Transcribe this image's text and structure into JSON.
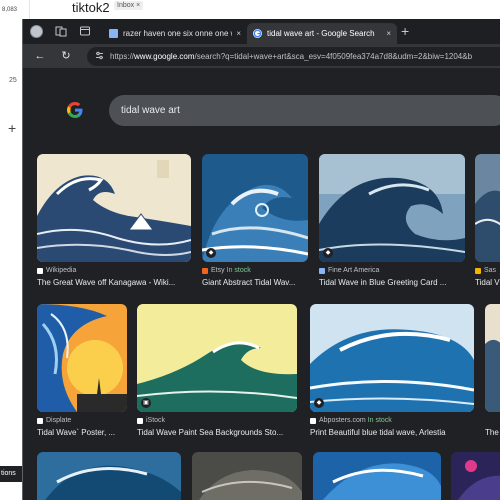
{
  "background_page": {
    "title": "tiktok2",
    "inbox_badge": "Inbox",
    "count": "8,083",
    "left_number": "25",
    "plus": "+",
    "bottom_tip": "tions"
  },
  "tabs": [
    {
      "label": "razer haven one six onne one wo",
      "close": "×",
      "active": false
    },
    {
      "label": "tidal wave art - Google Search",
      "close": "×",
      "active": true
    }
  ],
  "new_tab": "+",
  "toolbar": {
    "back": "←",
    "reload": "↻",
    "url_scheme": "https://",
    "url_host": "www.google.com",
    "url_rest": "/search?q=tidal+wave+art&sca_esv=4f0509fea374a7d8&udm=2&biw=1204&b"
  },
  "search": {
    "query": "tidal wave art"
  },
  "results": [
    {
      "source": "Wikipedia",
      "stock": "",
      "title": "The Great Wave off Kanagawa - Wiki..."
    },
    {
      "source": "Etsy",
      "stock": "In stock",
      "title": "Giant Abstract Tidal Wav..."
    },
    {
      "source": "Fine Art America",
      "stock": "",
      "title": "Tidal Wave in Blue Greeting Card ..."
    },
    {
      "source": "Sas",
      "stock": "",
      "title": "Tidal V"
    },
    {
      "source": "Displate",
      "stock": "",
      "title": "Tidal Wave` Poster, ..."
    },
    {
      "source": "iStock",
      "stock": "",
      "title": "Tidal Wave Paint Sea Backgrounds Sto..."
    },
    {
      "source": "Abposters.com",
      "stock": "In stock",
      "title": "Print Beautiful blue tidal wave, Arlestia"
    },
    {
      "source": "",
      "stock": "",
      "title": "The"
    }
  ],
  "colors": {
    "window_bg": "#202124",
    "searchbox_bg": "#4d5156",
    "stock_green": "#81c995"
  }
}
